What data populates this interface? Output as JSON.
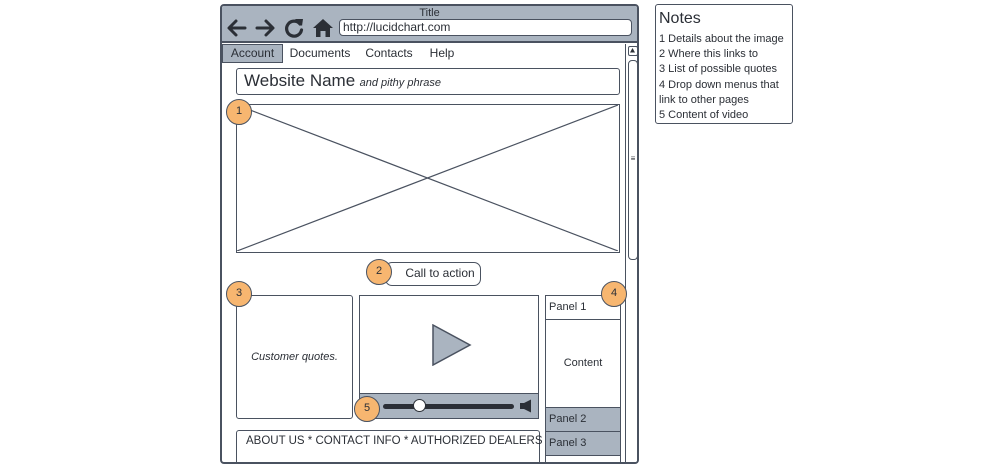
{
  "browser": {
    "title": "Title",
    "url": "http://lucidchart.com",
    "nav_icons": [
      "back-arrow-icon",
      "forward-arrow-icon",
      "refresh-icon",
      "home-icon"
    ]
  },
  "menu": [
    "Account",
    "Documents",
    "Contacts",
    "Help"
  ],
  "site": {
    "name": "Website Name",
    "phrase": "and pithy phrase"
  },
  "cta_label": "Call to action",
  "quotes_text": "Customer quotes.",
  "accordion": {
    "panel1": "Panel 1",
    "content": "Content",
    "panel2": "Panel 2",
    "panel3": "Panel 3"
  },
  "footer_text": "ABOUT US  * CONTACT INFO * AUTHORIZED DEALERS",
  "callouts": [
    "1",
    "2",
    "3",
    "4",
    "5"
  ],
  "notes": {
    "title": "Notes",
    "lines": [
      "1 Details about the image",
      "2 Where this links to",
      "3 List of possible quotes",
      "4 Drop down menus that",
      "link to other pages",
      "5 Content of video"
    ]
  },
  "colors": {
    "frame": "#4a5260",
    "fill_gray": "#aab4c0",
    "callout": "#f7b670"
  }
}
